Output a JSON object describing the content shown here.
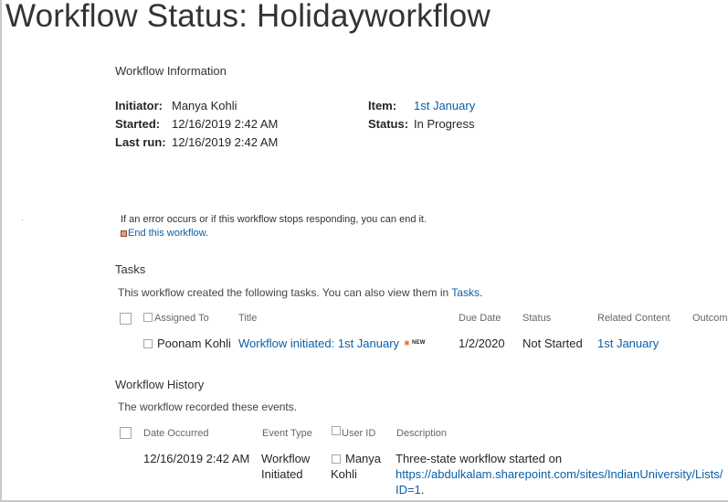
{
  "page": {
    "title": "Workflow Status: Holidayworkflow"
  },
  "workflow_info": {
    "heading": "Workflow Information",
    "initiator_label": "Initiator:",
    "initiator_value": "Manya Kohli",
    "started_label": "Started:",
    "started_value": "12/16/2019 2:42 AM",
    "last_run_label": "Last run:",
    "last_run_value": "12/16/2019 2:42 AM",
    "item_label": "Item:",
    "item_value": "1st January",
    "status_label": "Status:",
    "status_value": "In Progress"
  },
  "error_notice": {
    "text": "If an error occurs or if this workflow stops responding, you can end it.",
    "end_link": "End this workflow",
    "end_suffix": "."
  },
  "tasks": {
    "heading": "Tasks",
    "description": "This workflow created the following tasks. You can also view them in ",
    "tasks_link": "Tasks",
    "description_suffix": ".",
    "columns": {
      "assigned_to": "Assigned To",
      "title": "Title",
      "due_date": "Due Date",
      "status": "Status",
      "related_content": "Related Content",
      "outcome": "Outcome"
    },
    "rows": [
      {
        "assigned_to": "Poonam Kohli",
        "title": "Workflow initiated: 1st January",
        "new_badge": "NEW",
        "due_date": "1/2/2020",
        "status": "Not Started",
        "related_content": "1st January"
      }
    ]
  },
  "history": {
    "heading": "Workflow History",
    "description": "The workflow recorded these events.",
    "columns": {
      "date_occurred": "Date Occurred",
      "event_type": "Event Type",
      "user_id": "User ID",
      "description": "Description"
    },
    "rows": [
      {
        "date_occurred": "12/16/2019 2:42 AM",
        "event_type_line1": "Workflow",
        "event_type_line2": "Initiated",
        "user_line1": "Manya",
        "user_line2": "Kohli",
        "description_line1": "Three-state workflow started on",
        "description_url": "https://abdulkalam.sharepoint.com/sites/IndianUniversity/Lists/",
        "description_url_end": "ID=1",
        "description_suffix": "."
      }
    ]
  },
  "colors": {
    "link": "#0a5fa8",
    "text": "#262626",
    "muted": "#666666"
  }
}
